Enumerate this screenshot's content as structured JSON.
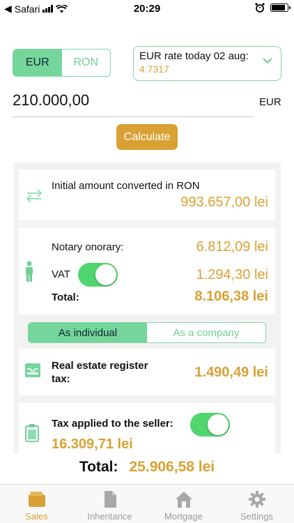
{
  "status_bar": {
    "carrier": "Safari",
    "time": "20:29"
  },
  "currency_toggle": {
    "options": [
      "EUR",
      "RON"
    ],
    "selected": "EUR"
  },
  "rate": {
    "title": "EUR rate today 02 aug:",
    "value": "4.7317"
  },
  "amount": {
    "value": "210.000,00",
    "currency": "EUR"
  },
  "calculate_label": "Calculate",
  "converted": {
    "label": "Initial amount converted in RON",
    "value": "993.657,00 lei"
  },
  "notary": {
    "onorary_label": "Notary onorary:",
    "onorary_value": "6.812,09 lei",
    "vat_label": "VAT",
    "vat_enabled": true,
    "vat_value": "1.294,30 lei",
    "total_label": "Total:",
    "total_value": "8.106,38 lei"
  },
  "person_type": {
    "options": [
      "As individual",
      "As a company"
    ],
    "selected": "As individual"
  },
  "register_tax": {
    "label_line1": "Real estate register",
    "label_line2": "tax:",
    "value": "1.490,49 lei"
  },
  "seller_tax": {
    "label": "Tax applied to the seller:",
    "enabled": true,
    "value": "16.309,71 lei"
  },
  "grand_total": {
    "label": "Total:",
    "value": "25.906,58 lei"
  },
  "tabs": [
    {
      "label": "Sales",
      "icon": "wallet-icon",
      "active": true
    },
    {
      "label": "Inheritance",
      "icon": "document-icon",
      "active": false
    },
    {
      "label": "Mortgage",
      "icon": "house-icon",
      "active": false
    },
    {
      "label": "Settings",
      "icon": "gear-icon",
      "active": false
    }
  ],
  "colors": {
    "accent_green": "#74d69b",
    "accent_gold": "#d9a134",
    "toggle_green": "#4fd66e"
  }
}
